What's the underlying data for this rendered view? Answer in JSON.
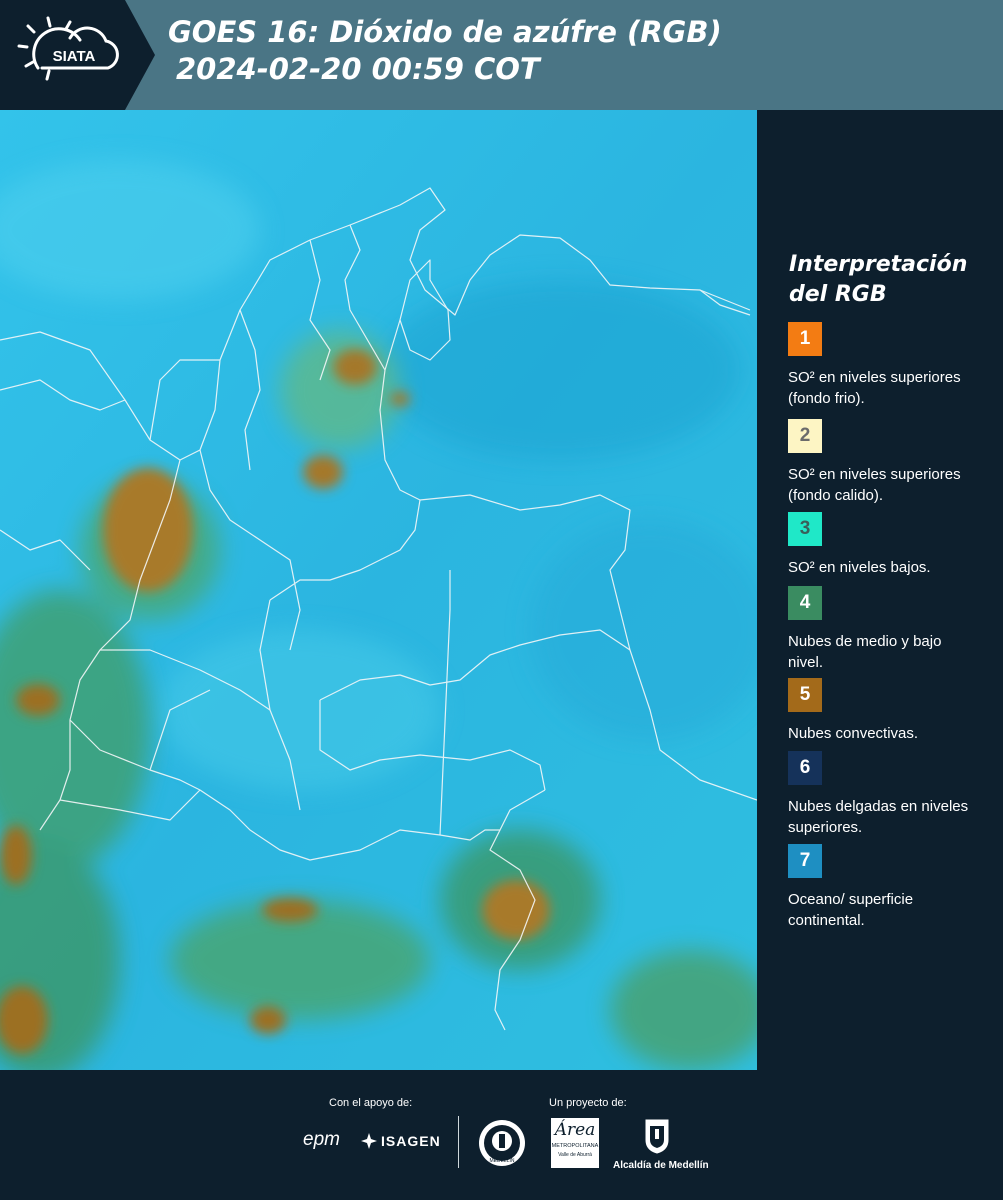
{
  "header": {
    "logo_text": "SIATA",
    "title_line1": "GOES 16: Dióxido de azúfre (RGB)",
    "title_line2": "2024-02-20 00:59 COT"
  },
  "legend": {
    "title_line1": "Interpretación",
    "title_line2": "del RGB",
    "items": [
      {
        "number": "1",
        "color": "#f37c13",
        "text": "SO² en niveles superiores (fondo frio)."
      },
      {
        "number": "2",
        "color": "#fdf5c4",
        "text": "SO² en niveles superiores (fondo calido)."
      },
      {
        "number": "3",
        "color": "#1fe8c8",
        "text": "SO² en niveles bajos."
      },
      {
        "number": "4",
        "color": "#3a8c61",
        "text": "Nubes de medio y bajo nivel."
      },
      {
        "number": "5",
        "color": "#a36a1a",
        "text": "Nubes convectivas."
      },
      {
        "number": "6",
        "color": "#15325a",
        "text": "Nubes delgadas en niveles superiores."
      },
      {
        "number": "7",
        "color": "#1e8fc2",
        "text": "Oceano/ superficie continental."
      }
    ]
  },
  "footer": {
    "support_label": "Con el apoyo de:",
    "project_label": "Un proyecto de:",
    "epm": "epm",
    "isagen": "ISAGEN",
    "area_metro": "Área",
    "area_metro_sub": "METROPOLITANA",
    "area_metro_sub2": "Valle de Aburrá",
    "alcaldia": "Alcaldía de Medellín",
    "medellin_seal": "MEDELLÍN"
  }
}
